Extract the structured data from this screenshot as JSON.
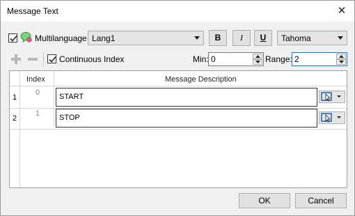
{
  "window": {
    "title": "Message Text",
    "close_glyph": "✕"
  },
  "toolbar": {
    "multilanguage_label": "Multilanguage",
    "multilanguage_checked": true,
    "language_value": "Lang1",
    "bold_label": "B",
    "italic_label": "I",
    "underline_label": "U",
    "font_value": "Tahoma",
    "continuous_index_label": "Continuous Index",
    "continuous_index_checked": true,
    "min_label": "Min:",
    "min_value": "0",
    "range_label": "Range:",
    "range_value": "2"
  },
  "grid": {
    "columns": [
      "Index",
      "Message Description"
    ],
    "rows": [
      {
        "row_number": "1",
        "index": "0",
        "description": "START"
      },
      {
        "row_number": "2",
        "index": "1",
        "description": "STOP"
      }
    ]
  },
  "footer": {
    "ok_label": "OK",
    "cancel_label": "Cancel"
  },
  "colors": {
    "accent": "#0078d7",
    "speech_icon": "#5cb85c"
  }
}
